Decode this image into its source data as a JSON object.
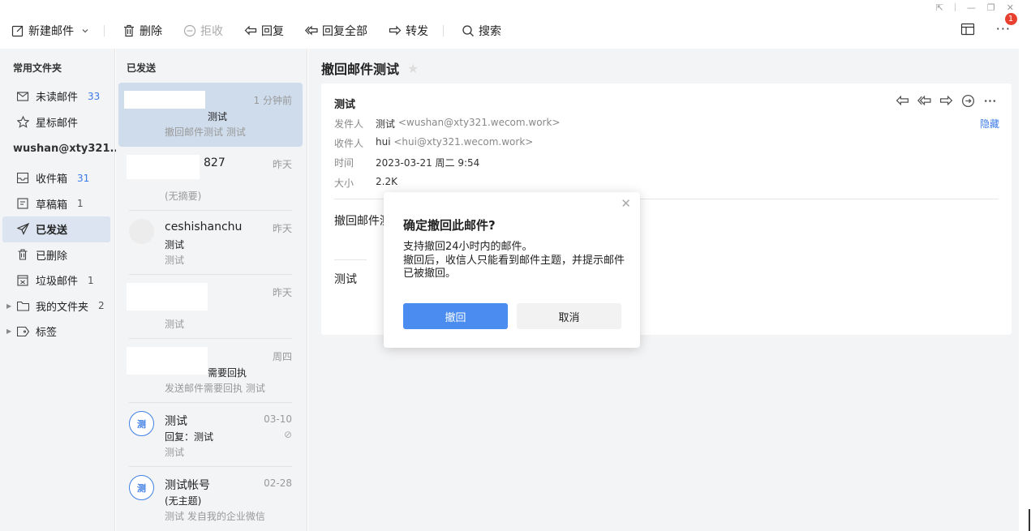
{
  "toolbar": {
    "new_mail": "新建邮件",
    "delete": "删除",
    "reject": "拒收",
    "reply": "回复",
    "reply_all": "回复全部",
    "forward": "转发",
    "search": "搜索",
    "notify_count": "1"
  },
  "sidebar": {
    "common_folders": "常用文件夹",
    "unread": {
      "label": "未读邮件",
      "count": "33"
    },
    "starred": {
      "label": "星标邮件"
    },
    "account": "wushan@xty321....",
    "inbox": {
      "label": "收件箱",
      "count": "31"
    },
    "drafts": {
      "label": "草稿箱",
      "count": "1"
    },
    "sent": {
      "label": "已发送"
    },
    "deleted": {
      "label": "已删除"
    },
    "spam": {
      "label": "垃圾邮件",
      "count": "1"
    },
    "my_folders": {
      "label": "我的文件夹",
      "count": "2"
    },
    "tags": {
      "label": "标签"
    }
  },
  "list": {
    "title": "已发送",
    "items": [
      {
        "from": "",
        "time": "1 分钟前",
        "subject": "测试",
        "summary": "撤回邮件测试 测试"
      },
      {
        "from": "827",
        "time": "昨天",
        "subject": "",
        "summary": "(无摘要)"
      },
      {
        "from": "ceshishanchu",
        "time": "昨天",
        "subject": "测试",
        "summary": "测试"
      },
      {
        "from": "",
        "time": "昨天",
        "subject": "",
        "summary": "测试"
      },
      {
        "from": "",
        "time": "周四",
        "subject": "需要回执",
        "summary": "发送邮件需要回执 测试"
      },
      {
        "avatar": "测",
        "from": "测试",
        "time": "03-10",
        "subject": "回复：测试",
        "summary": "测试"
      },
      {
        "avatar": "测",
        "from": "测试帐号",
        "time": "02-28",
        "subject": "(无主题)",
        "summary": "测试 发自我的企业微信"
      }
    ]
  },
  "reader": {
    "title": "撤回邮件测试",
    "sender_name": "测试",
    "from_label": "发件人",
    "from_name": "测试",
    "from_addr": "<wushan@xty321.wecom.work>",
    "to_label": "收件人",
    "to_name": "hui",
    "to_addr": "<hui@xty321.wecom.work>",
    "time_label": "时间",
    "time_value": "2023-03-21 周二 9:54",
    "size_label": "大小",
    "size_value": "2.2K",
    "hide": "隐藏",
    "body_line1": "撤回邮件测",
    "body_line2": "测试"
  },
  "dialog": {
    "title": "确定撤回此邮件?",
    "text1": "支持撤回24小时内的邮件。",
    "text2": "撤回后，收信人只能看到邮件主题，并提示邮件已被撤回。",
    "ok": "撤回",
    "cancel": "取消"
  },
  "colors": {
    "accent": "#4a8cef",
    "badge": "#e8402f",
    "link": "#3c7ce8",
    "selected": "#cfdcec"
  }
}
